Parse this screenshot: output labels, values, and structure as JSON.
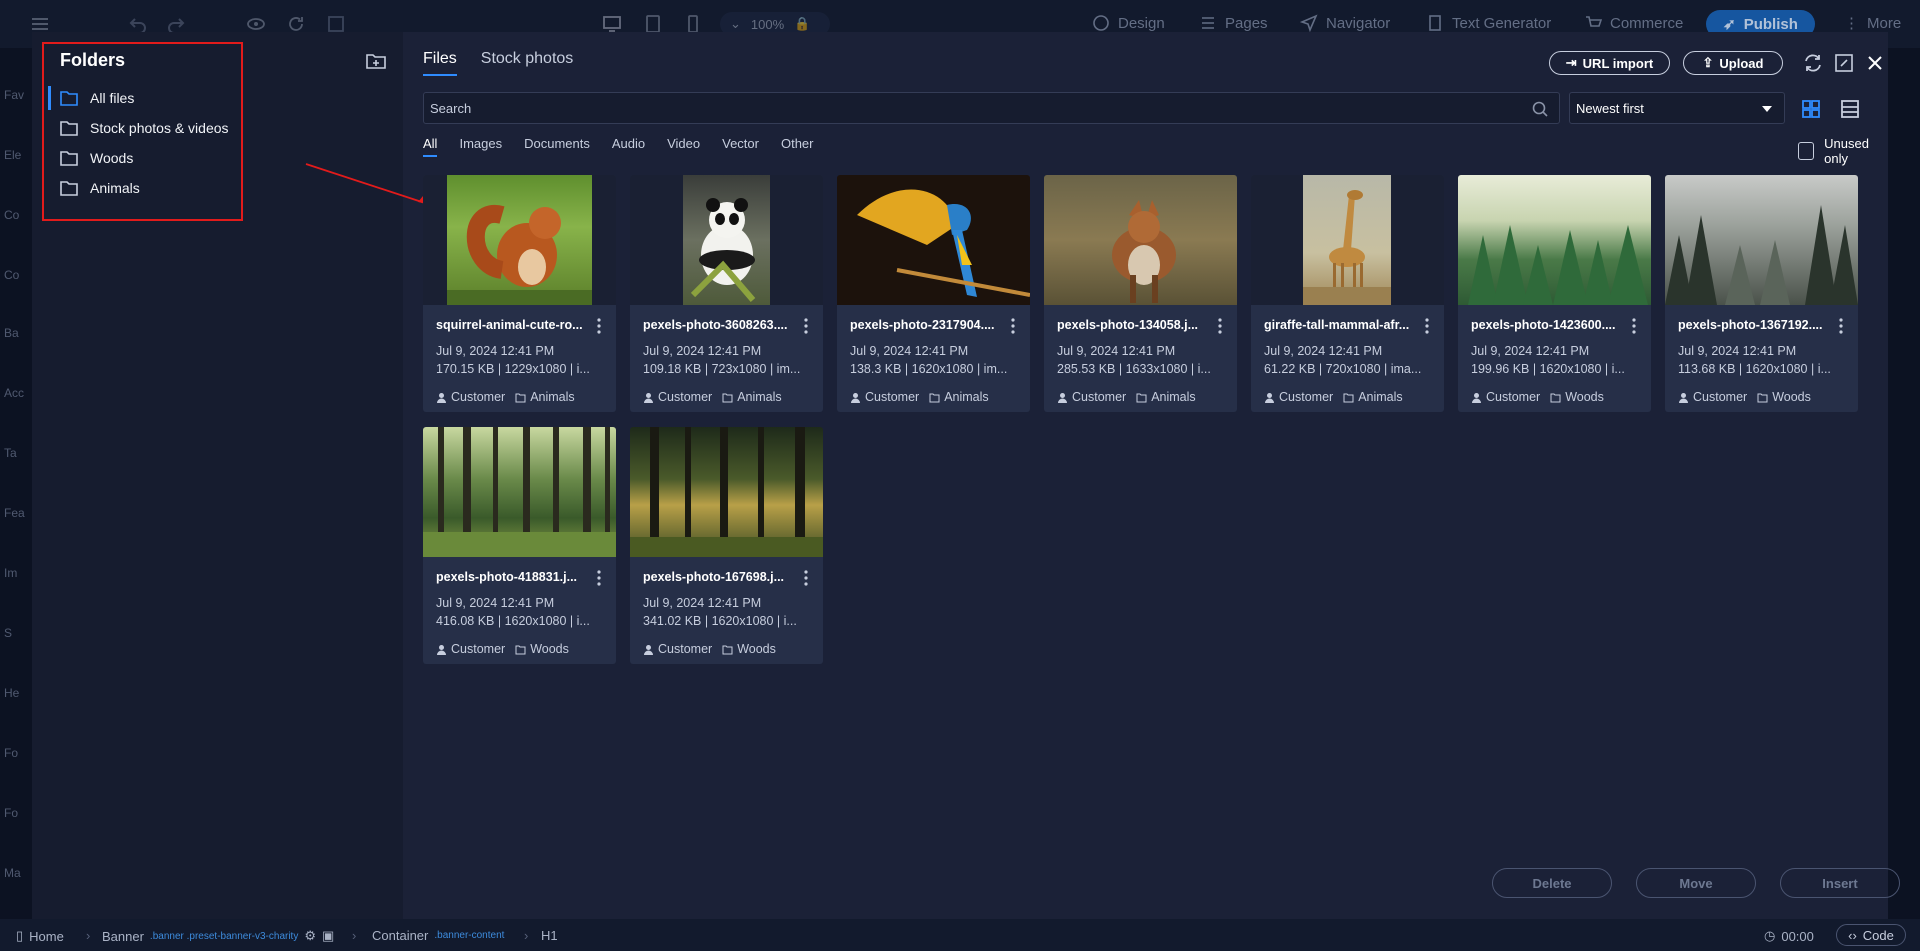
{
  "toolbar": {
    "zoom": "100%",
    "nav": [
      "Design",
      "Pages",
      "Navigator",
      "Text Generator",
      "Commerce"
    ],
    "publish": "Publish",
    "more": "More"
  },
  "left_strip": [
    "Fav",
    "Ele",
    "Co",
    "Co",
    "Ba",
    "Acc",
    "Ta",
    "Fea",
    "Im",
    "S",
    "He",
    "Fo",
    "Fo",
    "Ma"
  ],
  "folders": {
    "title": "Folders",
    "items": [
      "All files",
      "Stock photos & videos",
      "Woods",
      "Animals"
    ]
  },
  "tabs": [
    "Files",
    "Stock photos"
  ],
  "header": {
    "url_import": "URL import",
    "upload": "Upload"
  },
  "search": {
    "placeholder": "Search"
  },
  "sort": {
    "selected": "Newest first"
  },
  "filters": [
    "All",
    "Images",
    "Documents",
    "Audio",
    "Video",
    "Vector",
    "Other"
  ],
  "unused_only": "Unused only",
  "files": [
    {
      "name": "squirrel-animal-cute-ro...",
      "date": "Jul 9, 2024 12:41 PM",
      "meta": "170.15 KB | 1229x1080 | i...",
      "author": "Customer",
      "folder": "Animals",
      "thumb": "squirrel"
    },
    {
      "name": "pexels-photo-3608263....",
      "date": "Jul 9, 2024 12:41 PM",
      "meta": "109.18 KB | 723x1080 | im...",
      "author": "Customer",
      "folder": "Animals",
      "thumb": "panda"
    },
    {
      "name": "pexels-photo-2317904....",
      "date": "Jul 9, 2024 12:41 PM",
      "meta": "138.3 KB | 1620x1080 | im...",
      "author": "Customer",
      "folder": "Animals",
      "thumb": "parrot"
    },
    {
      "name": "pexels-photo-134058.j...",
      "date": "Jul 9, 2024 12:41 PM",
      "meta": "285.53 KB | 1633x1080 | i...",
      "author": "Customer",
      "folder": "Animals",
      "thumb": "fox"
    },
    {
      "name": "giraffe-tall-mammal-afr...",
      "date": "Jul 9, 2024 12:41 PM",
      "meta": "61.22 KB | 720x1080 | ima...",
      "author": "Customer",
      "folder": "Animals",
      "thumb": "giraffe"
    },
    {
      "name": "pexels-photo-1423600....",
      "date": "Jul 9, 2024 12:41 PM",
      "meta": "199.96 KB | 1620x1080 | i...",
      "author": "Customer",
      "folder": "Woods",
      "thumb": "foggy-forest"
    },
    {
      "name": "pexels-photo-1367192....",
      "date": "Jul 9, 2024 12:41 PM",
      "meta": "113.68 KB | 1620x1080 | i...",
      "author": "Customer",
      "folder": "Woods",
      "thumb": "misty-forest"
    },
    {
      "name": "pexels-photo-418831.j...",
      "date": "Jul 9, 2024 12:41 PM",
      "meta": "416.08 KB | 1620x1080 | i...",
      "author": "Customer",
      "folder": "Woods",
      "thumb": "sunlit-forest"
    },
    {
      "name": "pexels-photo-167698.j...",
      "date": "Jul 9, 2024 12:41 PM",
      "meta": "341.02 KB | 1620x1080 | i...",
      "author": "Customer",
      "folder": "Woods",
      "thumb": "golden-forest"
    }
  ],
  "actions": [
    "Delete",
    "Move",
    "Insert"
  ],
  "breadcrumb": {
    "home": "Home",
    "banner": "Banner",
    "banner_class": ".banner .preset-banner-v3-charity",
    "container": "Container",
    "container_class": ".banner-content",
    "h1": "H1",
    "time": "00:00",
    "code": "Code"
  },
  "colors": {
    "accent": "#2f8cff",
    "annotation": "#e21b1b",
    "modal_bg": "#1b2137",
    "card_bg": "#262f48"
  }
}
